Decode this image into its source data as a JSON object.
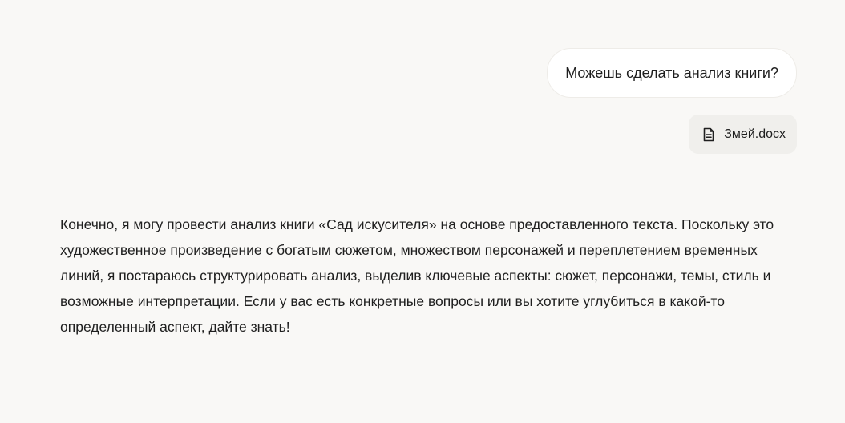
{
  "conversation": {
    "user_message": "Можешь сделать анализ книги?",
    "attachment": {
      "icon": "document-icon",
      "filename": "Змей.docx"
    },
    "assistant_message": "Конечно, я могу провести анализ книги «Сад искусителя» на основе предоставленного текста. Поскольку это художественное произведение с богатым сюжетом, множеством персонажей и переплетением временных линий, я постараюсь структурировать анализ, выделив ключевые аспекты: сюжет, персонажи, темы, стиль и возможные интерпретации. Если у вас есть конкретные вопросы или вы хотите углубиться в какой-то определенный аспект, дайте знать!"
  },
  "colors": {
    "background": "#f9f8f6",
    "user_bubble": "#ffffff",
    "attachment_chip": "#f0efec",
    "text": "#1f1f1f"
  }
}
